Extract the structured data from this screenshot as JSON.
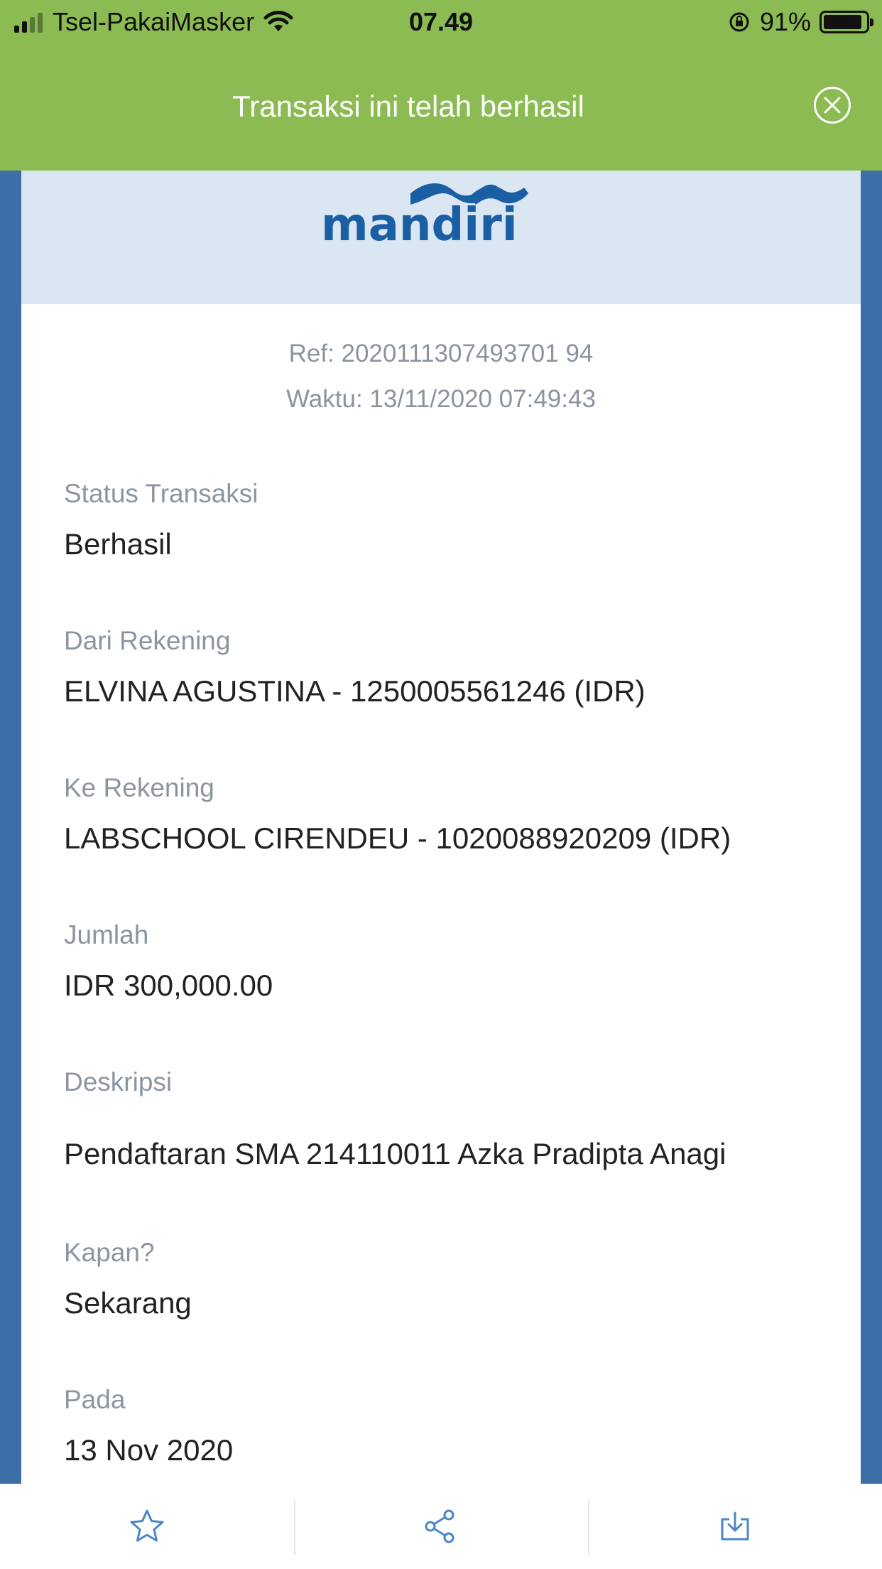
{
  "status_bar": {
    "carrier": "Tsel-PakaiMasker",
    "time": "07.49",
    "battery_percent": "91%",
    "battery_level": 0.91,
    "icons": [
      "signal-icon",
      "wifi-icon",
      "orientation-lock-icon",
      "battery-icon"
    ]
  },
  "banner": {
    "message": "Transaksi ini telah berhasil",
    "close_icon": "close-circle-icon",
    "color": "#8bbb52"
  },
  "receipt": {
    "logo_text": "mandiri",
    "ref": "Ref: 2020111307493701 94",
    "waktu": "Waktu: 13/11/2020 07:49:43",
    "fields": [
      {
        "label": "Status Transaksi",
        "value": "Berhasil"
      },
      {
        "label": "Dari Rekening",
        "value": "ELVINA AGUSTINA - 1250005561246 (IDR)"
      },
      {
        "label": "Ke Rekening",
        "value": "LABSCHOOL CIRENDEU - 1020088920209 (IDR)"
      },
      {
        "label": "Jumlah",
        "value": "IDR 300,000.00"
      },
      {
        "label": "Deskripsi",
        "value": "Pendaftaran SMA 214110011 Azka Pradipta Anagi"
      },
      {
        "label": "Kapan?",
        "value": "Sekarang"
      },
      {
        "label": "Pada",
        "value": "13 Nov 2020"
      }
    ]
  },
  "toolbar": {
    "icons": [
      "star-icon",
      "share-icon",
      "download-icon"
    ],
    "accent": "#4a86c8"
  },
  "colors": {
    "brand_blue": "#1a5ea3",
    "logo_bg": "#dae6f1",
    "side_blue": "#3c6fa8"
  }
}
